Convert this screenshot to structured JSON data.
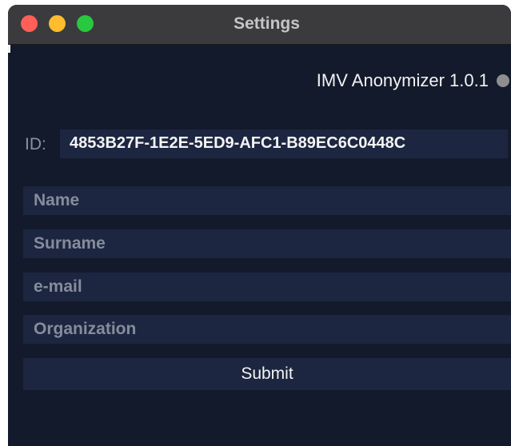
{
  "window": {
    "title": "Settings"
  },
  "header": {
    "app_name": "IMV Anonymizer 1.0.1",
    "status_color": "#8e8e8e"
  },
  "identity": {
    "label": "ID:",
    "value": "4853B27F-1E2E-5ED9-AFC1-B89EC6C0448C"
  },
  "form": {
    "name_placeholder": "Name",
    "surname_placeholder": "Surname",
    "email_placeholder": "e-mail",
    "organization_placeholder": "Organization",
    "submit_label": "Submit"
  },
  "colors": {
    "background": "#121a2c",
    "field_background": "#1c2640",
    "titlebar": "#3b3a3d",
    "close": "#fe5f57",
    "minimize": "#febc2e",
    "zoom": "#28c840"
  }
}
